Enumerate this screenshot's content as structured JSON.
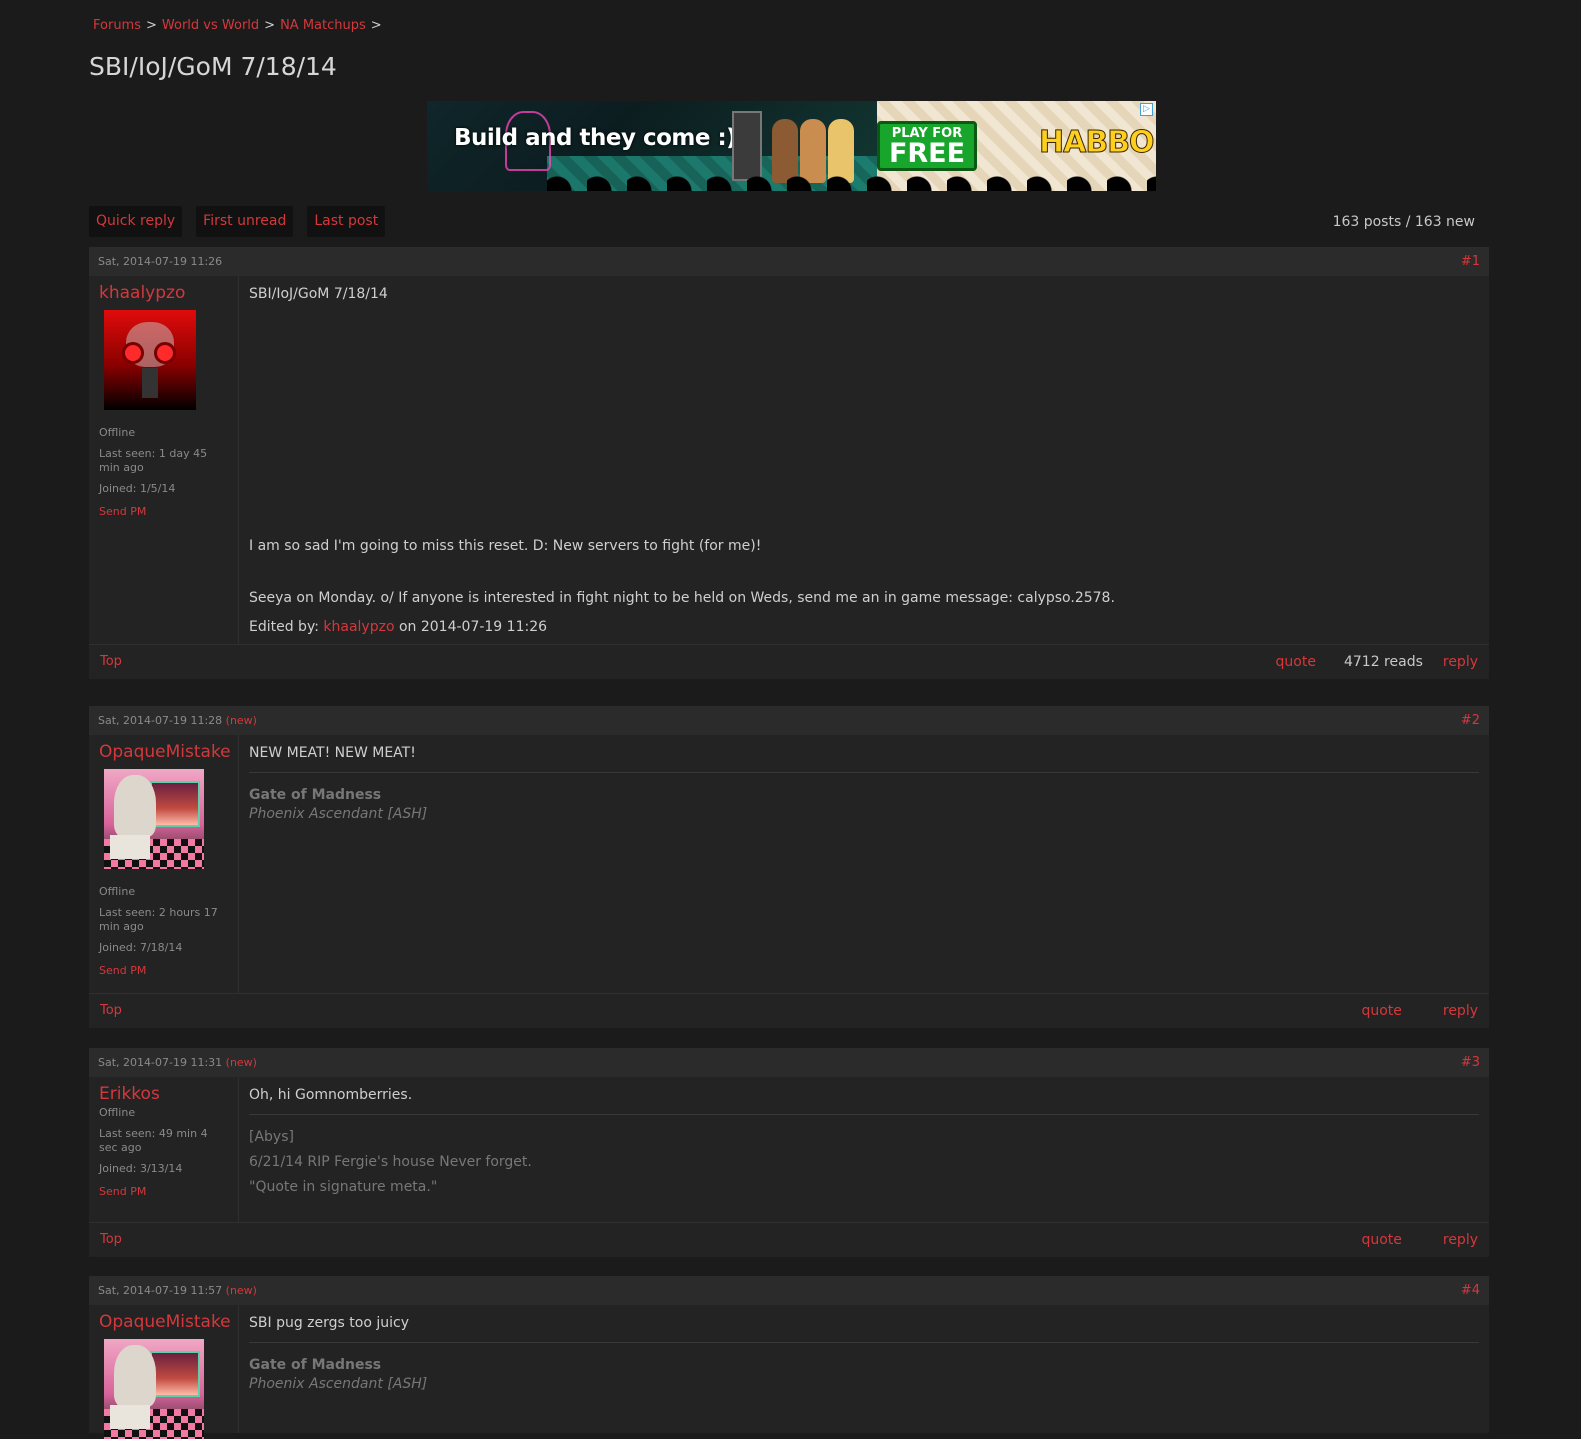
{
  "breadcrumb": [
    "Forums",
    "World vs World",
    "NA Matchups"
  ],
  "breadcrumb_sep": ">",
  "title": "SBI/IoJ/GoM 7/18/14",
  "ad": {
    "headline": "Build and they come :)",
    "cta_small": "PLAY FOR",
    "cta_big": "FREE",
    "brand": "HABBO",
    "adchoice": "▷"
  },
  "actions": {
    "quick_reply": "Quick reply",
    "first_unread": "First unread",
    "last_post": "Last post"
  },
  "post_count": "163 posts / 163 new",
  "posts": [
    {
      "date": "Sat, 2014-07-19 11:26",
      "new": "",
      "num": "#1",
      "author": "khaalypzo",
      "status": "Offline",
      "last_seen": "Last seen: 1 day 45 min ago",
      "joined": "Joined: 1/5/14",
      "send_pm": "Send PM",
      "lines": [
        "SBI/IoJ/GoM 7/18/14",
        "I am so sad I'm going to miss this reset. D: New servers to fight (for me)!",
        "Seeya on Monday. o/ If anyone is interested in fight night to be held on Weds, send me an in game message: calypso.2578."
      ],
      "edited_prefix": "Edited by:",
      "edited_by": "khaalypzo",
      "edited_suffix": "on 2014-07-19 11:26",
      "top": "Top",
      "quote": "quote",
      "reads": "4712 reads",
      "reply": "reply"
    },
    {
      "date": "Sat, 2014-07-19 11:28",
      "new": "(new)",
      "num": "#2",
      "author": "OpaqueMistake",
      "status": "Offline",
      "last_seen": "Last seen: 2 hours 17 min ago",
      "joined": "Joined: 7/18/14",
      "send_pm": "Send PM",
      "text": "NEW MEAT! NEW MEAT!",
      "sig_bold": "Gate of Madness",
      "sig_italic": "Phoenix Ascendant [ASH]",
      "top": "Top",
      "quote": "quote",
      "reply": "reply"
    },
    {
      "date": "Sat, 2014-07-19 11:31",
      "new": "(new)",
      "num": "#3",
      "author": "Erikkos",
      "status": "Offline",
      "last_seen": "Last seen: 49 min 4 sec ago",
      "joined": "Joined: 3/13/14",
      "send_pm": "Send PM",
      "text": "Oh, hi Gomnomberries.",
      "sig_lines": [
        "[Abys]",
        "6/21/14 RIP Fergie's house Never forget.",
        "\"Quote in signature meta.\""
      ],
      "top": "Top",
      "quote": "quote",
      "reply": "reply"
    },
    {
      "date": "Sat, 2014-07-19 11:57",
      "new": "(new)",
      "num": "#4",
      "author": "OpaqueMistake",
      "text": "SBI pug zergs too juicy",
      "sig_bold": "Gate of Madness",
      "sig_italic": "Phoenix Ascendant [ASH]"
    }
  ],
  "colors": {
    "accent": "#d4383c",
    "background": "#1b1b1b",
    "post_bg": "#232323",
    "header_bg": "#2b2b2b"
  }
}
